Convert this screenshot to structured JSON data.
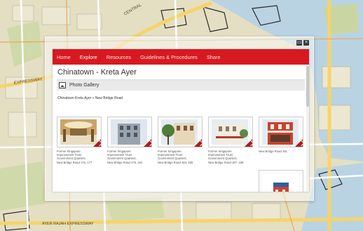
{
  "map": {
    "road_labels": [
      "CENTRAL",
      "EXPRESSWAY",
      "AYER RAJAH EXPRESSWAY"
    ]
  },
  "window": {
    "controls": [
      "minimize-icon",
      "close-icon"
    ]
  },
  "nav": {
    "items": [
      {
        "label": "Home",
        "active": false
      },
      {
        "label": "Explore",
        "active": true
      },
      {
        "label": "Resources",
        "active": false
      },
      {
        "label": "Guidelines & Procedures",
        "active": false
      },
      {
        "label": "Share",
        "active": false
      }
    ],
    "color": "#d71920"
  },
  "page": {
    "title": "Chinatown - Kreta Ayer"
  },
  "gallery": {
    "title": "Photo Gallery",
    "icon": "image-icon"
  },
  "breadcrumb": {
    "parent": "Chinatown Kreta Ayer",
    "separator": "»",
    "current": "New Bridge Road"
  },
  "tiles": [
    {
      "caption": "Former Singapore\nImprovement Trust\nGovernment Quarters,\nNew Bridge Road 175, 177",
      "scene": "interior"
    },
    {
      "caption": "Former Singapore\nImprovement Trust\nGovernment Quarters,\nNew Bridge Road 175, 181",
      "scene": "shophouse-grey"
    },
    {
      "caption": "Former Singapore\nImprovement Trust\nGovernment Quarters,\nNew Bridge Road 183, 185",
      "scene": "shophouse-tree"
    },
    {
      "caption": "Former Singapore\nImprovement Trust\nGovernment Quarters,\nNew Bridge Road 187, 189",
      "scene": "shophouse-white"
    },
    {
      "caption": "New Bridge Road 191",
      "scene": "shophouse-red"
    },
    {
      "caption": "",
      "scene": "shophouse-red-partial"
    }
  ]
}
